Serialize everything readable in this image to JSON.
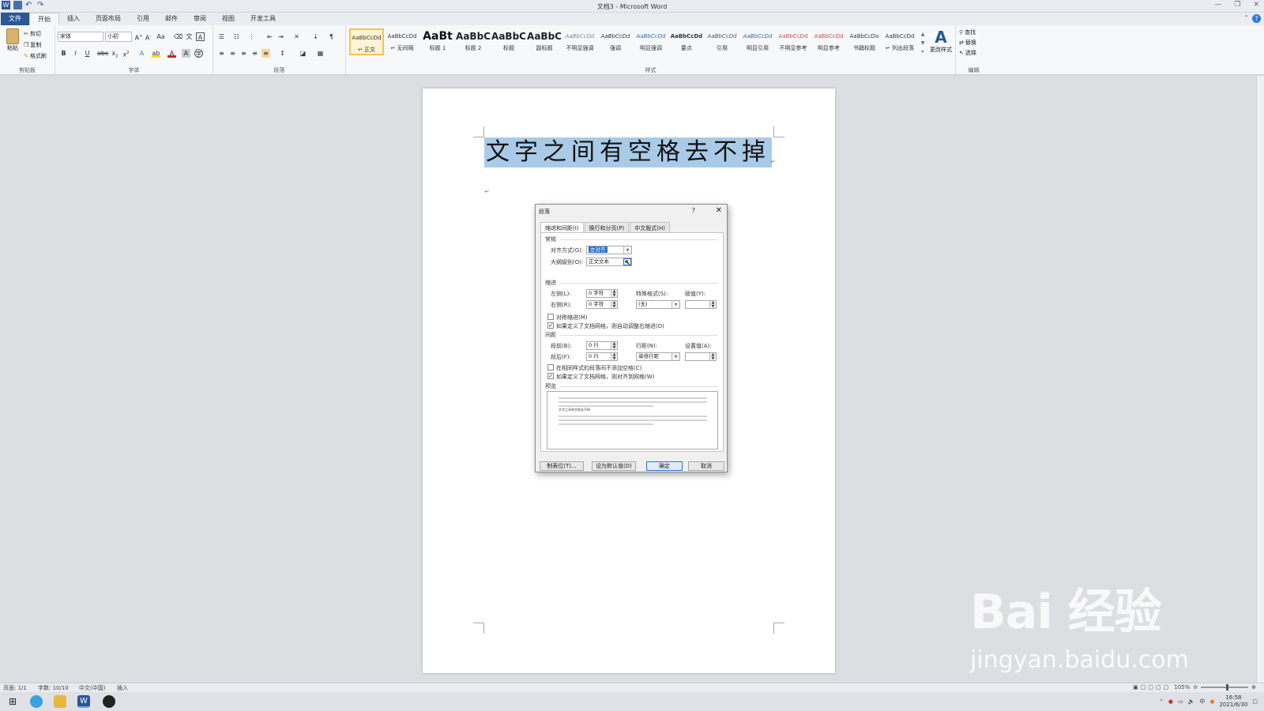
{
  "window": {
    "title": "文档3 - Microsoft Word",
    "controls": [
      "—",
      "❐",
      "✕"
    ]
  },
  "ribbon": {
    "tabs": [
      {
        "label": "文件",
        "file": true
      },
      {
        "label": "开始",
        "active": true
      },
      {
        "label": "插入"
      },
      {
        "label": "页面布局"
      },
      {
        "label": "引用"
      },
      {
        "label": "邮件"
      },
      {
        "label": "审阅"
      },
      {
        "label": "视图"
      },
      {
        "label": "开发工具"
      }
    ],
    "clipboard": {
      "paste": "粘贴",
      "cut": "剪切",
      "copy": "复制",
      "format_painter": "格式刷",
      "group": "剪贴板"
    },
    "font": {
      "family": "宋体",
      "size": "小初",
      "group": "字体"
    },
    "paragraph": {
      "group": "段落"
    },
    "styles": {
      "group": "样式",
      "items": [
        {
          "sample": "AaBbCcDd",
          "name": "↵ 正文",
          "selected": true,
          "size": 7,
          "color": "#333"
        },
        {
          "sample": "AaBbCcDd",
          "name": "↵ 无间隔",
          "size": 7,
          "color": "#333"
        },
        {
          "sample": "AaBt",
          "name": "标题 1",
          "size": 14,
          "color": "#111",
          "bold": true
        },
        {
          "sample": "AaBbC",
          "name": "标题 2",
          "size": 12,
          "color": "#222",
          "bold": true
        },
        {
          "sample": "AaBbC",
          "name": "标题",
          "size": 12,
          "color": "#222",
          "bold": true
        },
        {
          "sample": "AaBbC",
          "name": "副标题",
          "size": 12,
          "color": "#222",
          "bold": true
        },
        {
          "sample": "AaBbCcDd",
          "name": "不明显强调",
          "size": 7,
          "color": "#888",
          "italic": true
        },
        {
          "sample": "AaBbCcDd",
          "name": "强调",
          "size": 7,
          "color": "#333",
          "italic": true
        },
        {
          "sample": "AaBbCcDd",
          "name": "明显强调",
          "size": 7,
          "color": "#2b6cb5",
          "italic": true
        },
        {
          "sample": "AaBbCcDd",
          "name": "要点",
          "size": 7,
          "color": "#333",
          "bold": true
        },
        {
          "sample": "AaBbCcDd",
          "name": "引用",
          "size": 7,
          "color": "#555",
          "italic": true
        },
        {
          "sample": "AaBbCcDd",
          "name": "明显引用",
          "size": 7,
          "color": "#2b6cb5",
          "italic": true
        },
        {
          "sample": "AaBbCcDd",
          "name": "不明显参考",
          "size": 7,
          "color": "#c0504d"
        },
        {
          "sample": "AaBbCcDd",
          "name": "明显参考",
          "size": 7,
          "color": "#c0504d"
        },
        {
          "sample": "AaBbCcDo",
          "name": "书籍标题",
          "size": 7,
          "color": "#333"
        },
        {
          "sample": "AaBbCcDd",
          "name": "↵ 列出段落",
          "size": 7,
          "color": "#333"
        }
      ],
      "change_styles": "更改样式"
    },
    "editing": {
      "find": "查找",
      "replace": "替换",
      "select": "选择",
      "group": "编辑"
    }
  },
  "document": {
    "heading": "文字之间有空格去不掉"
  },
  "dialog": {
    "title": "段落",
    "help": "?",
    "close": "✕",
    "tabs": [
      "缩进和间距(I)",
      "换行和分页(P)",
      "中文版式(H)"
    ],
    "general": {
      "section": "常规",
      "alignment_label": "对齐方式(G):",
      "alignment_value": "左对齐",
      "outline_label": "大纲级别(O):",
      "outline_value": "正文文本"
    },
    "indent": {
      "section": "缩进",
      "left_label": "左侧(L):",
      "left_value": "0 字符",
      "right_label": "右侧(R):",
      "right_value": "0 字符",
      "special_label": "特殊格式(S):",
      "special_value": "(无)",
      "by_label": "磅值(Y):",
      "by_value": "",
      "mirror_label": "对称缩进(M)",
      "auto_adjust_label": "如果定义了文档网格，则自动调整右缩进(D)"
    },
    "spacing": {
      "section": "间距",
      "before_label": "段前(B):",
      "before_value": "0 行",
      "after_label": "段后(F):",
      "after_value": "0 行",
      "line_label": "行距(N):",
      "line_value": "单倍行距",
      "at_label": "设置值(A):",
      "at_value": "",
      "no_space_label": "在相同样式的段落间不添加空格(C)",
      "snap_grid_label": "如果定义了文档网格，则对齐到网格(W)"
    },
    "preview": {
      "section": "预览",
      "sample_text": "文字之间有空格去不掉"
    },
    "buttons": {
      "tabs": "制表位(T)...",
      "default": "设为默认值(D)",
      "ok": "确定",
      "cancel": "取消"
    }
  },
  "statusbar": {
    "page": "页面: 1/1",
    "words": "字数: 10/10",
    "language": "中文(中国)",
    "mode": "插入",
    "zoom": "105%"
  },
  "taskbar": {
    "time": "16:58",
    "date": "2021/6/30"
  },
  "watermark": {
    "brand": "Bai 经验",
    "url": "jingyan.baidu.com"
  }
}
